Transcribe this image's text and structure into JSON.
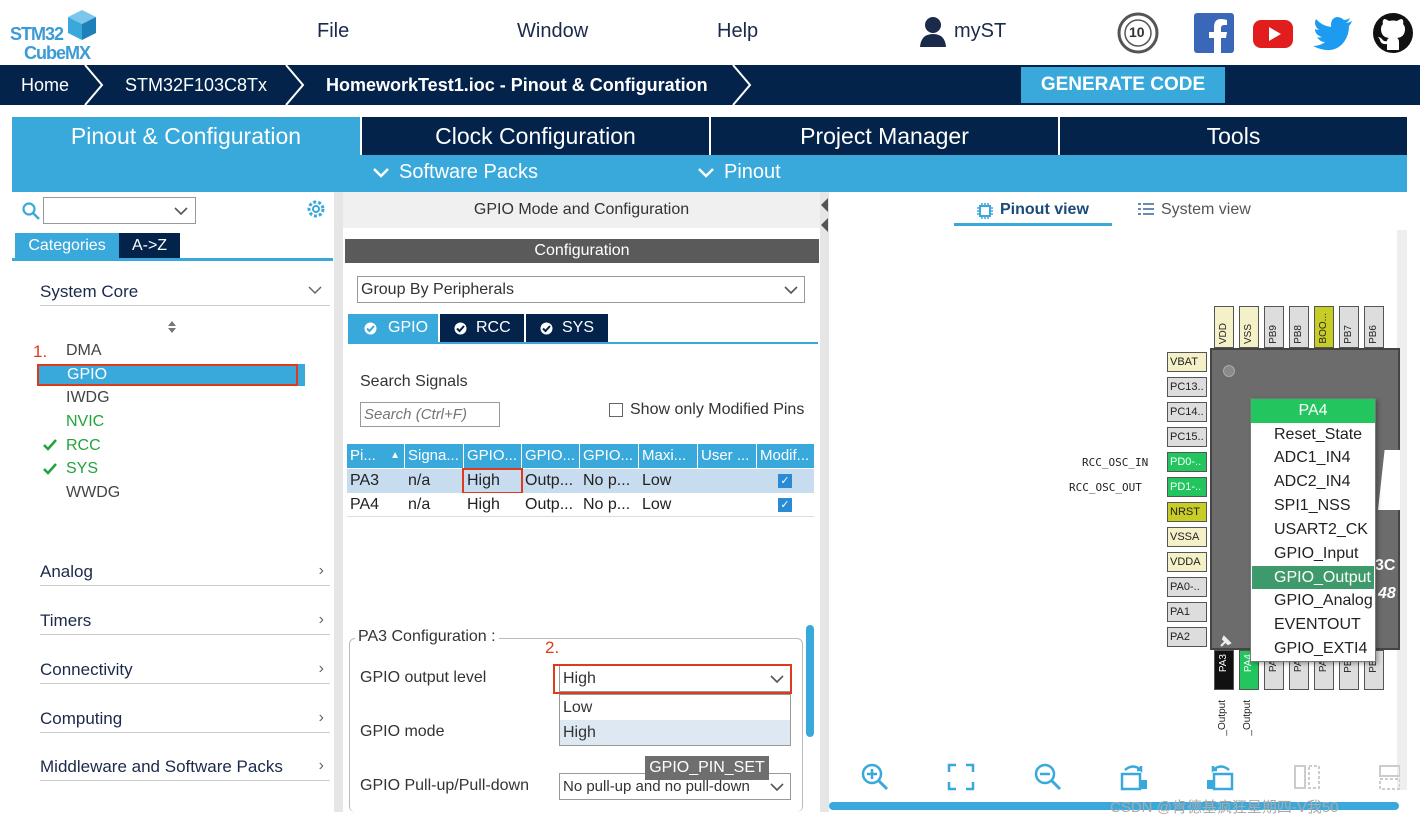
{
  "logo": {
    "line1": "STM32",
    "line2": "CubeMX"
  },
  "menu": {
    "file": "File",
    "window": "Window",
    "help": "Help",
    "account": "myST",
    "anniversary": "10"
  },
  "breadcrumb": {
    "home": "Home",
    "device": "STM32F103C8Tx",
    "project": "HomeworkTest1.ioc - Pinout & Configuration",
    "generate": "GENERATE CODE"
  },
  "main_tabs": [
    "Pinout & Configuration",
    "Clock Configuration",
    "Project Manager",
    "Tools"
  ],
  "sub_tabs": {
    "software_packs": "Software Packs",
    "pinout": "Pinout"
  },
  "left": {
    "view_tabs": [
      "Categories",
      "A->Z"
    ],
    "system_core": "System Core",
    "system_core_items": [
      "DMA",
      "GPIO",
      "IWDG",
      "NVIC",
      "RCC",
      "SYS",
      "WWDG"
    ],
    "categories": [
      "Analog",
      "Timers",
      "Connectivity",
      "Computing",
      "Middleware and Software Packs"
    ],
    "annotation": "1."
  },
  "middle": {
    "header": "GPIO Mode and Configuration",
    "config_title": "Configuration",
    "group_by": "Group By Peripherals",
    "peripheral_tabs": [
      "GPIO",
      "RCC",
      "SYS"
    ],
    "search_label": "Search Signals",
    "search_placeholder": "Search (Ctrl+F)",
    "show_modified": "Show only Modified Pins",
    "table_headers": [
      "Pi...",
      "Signa...",
      "GPIO...",
      "GPIO...",
      "GPIO...",
      "Maxi...",
      "User ...",
      "Modif..."
    ],
    "rows": [
      [
        "PA3",
        "n/a",
        "High",
        "Outp...",
        "No p...",
        "Low",
        "",
        "✓"
      ],
      [
        "PA4",
        "n/a",
        "High",
        "Outp...",
        "No p...",
        "Low",
        "",
        "✓"
      ]
    ],
    "pa3_config": "PA3 Configuration :",
    "annotation": "2.",
    "output_level_label": "GPIO output level",
    "output_level_value": "High",
    "output_level_options": [
      "Low",
      "High"
    ],
    "mode_label": "GPIO mode",
    "pull_label": "GPIO Pull-up/Pull-down",
    "pull_value": "No pull-up and no pull-down",
    "tooltip": "GPIO_PIN_SET"
  },
  "right": {
    "pinout_view": "Pinout view",
    "system_view": "System view",
    "left_pins": [
      "VBAT",
      "PC13..",
      "PC14..",
      "PC15..",
      "PD0-..",
      "PD1-..",
      "NRST",
      "VSSA",
      "VDDA",
      "PA0-..",
      "PA1",
      "PA2"
    ],
    "top_pins": [
      "VDD",
      "VSS",
      "PB9",
      "PB8",
      "BOO...",
      "PB7",
      "PB6"
    ],
    "bottom_pins": [
      "PA3",
      "PA4",
      "PA5",
      "PA6",
      "PA7",
      "PB0",
      "PB1"
    ],
    "osc_in": "RCC_OSC_IN",
    "osc_out": "RCC_OSC_OUT",
    "chip_partial_1": "3C",
    "chip_partial_2": "48",
    "bottom_labels": [
      "_Output",
      "_Output"
    ],
    "context_title": "PA4",
    "context_items": [
      "Reset_State",
      "ADC1_IN4",
      "ADC2_IN4",
      "SPI1_NSS",
      "USART2_CK",
      "GPIO_Input",
      "GPIO_Output",
      "GPIO_Analog",
      "EVENTOUT",
      "GPIO_EXTI4"
    ]
  },
  "watermark": "CSDN @肯德基疯狂星期四-V我50",
  "colors": {
    "navy": "#03234b",
    "accent": "#39a9dc",
    "green": "#22c55e",
    "yellow": "#c8cc26",
    "red_annot": "#e03a1c"
  }
}
